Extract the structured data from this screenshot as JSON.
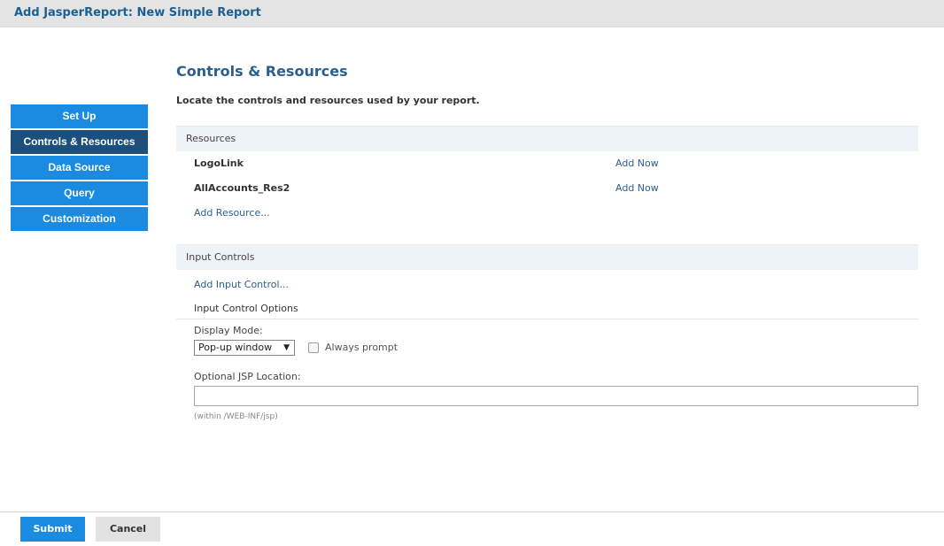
{
  "window": {
    "title": "Add JasperReport: New Simple Report"
  },
  "nav": {
    "items": [
      {
        "label": "Set Up"
      },
      {
        "label": "Controls & Resources"
      },
      {
        "label": "Data Source"
      },
      {
        "label": "Query"
      },
      {
        "label": "Customization"
      }
    ],
    "active_index": 1
  },
  "main": {
    "title": "Controls & Resources",
    "subtitle": "Locate the controls and resources used by your report.",
    "resources": {
      "header": "Resources",
      "rows": [
        {
          "name": "LogoLink",
          "action": "Add Now"
        },
        {
          "name": "AllAccounts_Res2",
          "action": "Add Now"
        }
      ],
      "add_link": "Add Resource..."
    },
    "input_controls": {
      "header": "Input Controls",
      "add_link": "Add Input Control...",
      "options_label": "Input Control Options",
      "display_mode": {
        "label": "Display Mode:",
        "selected": "Pop-up window",
        "always_prompt_label": "Always prompt",
        "always_prompt_checked": false
      },
      "jsp": {
        "label": "Optional JSP Location:",
        "value": "",
        "hint": "(within /WEB-INF/jsp)"
      }
    }
  },
  "footer": {
    "submit_label": "Submit",
    "cancel_label": "Cancel"
  },
  "colors": {
    "accent": "#1a8be0",
    "nav_active": "#1d4f7c",
    "link": "#2b5f8f",
    "section_bg": "#eef3f8",
    "titlebar_bg": "#e4e4e4"
  },
  "icons": {
    "select_arrow": "caret-down-icon"
  }
}
